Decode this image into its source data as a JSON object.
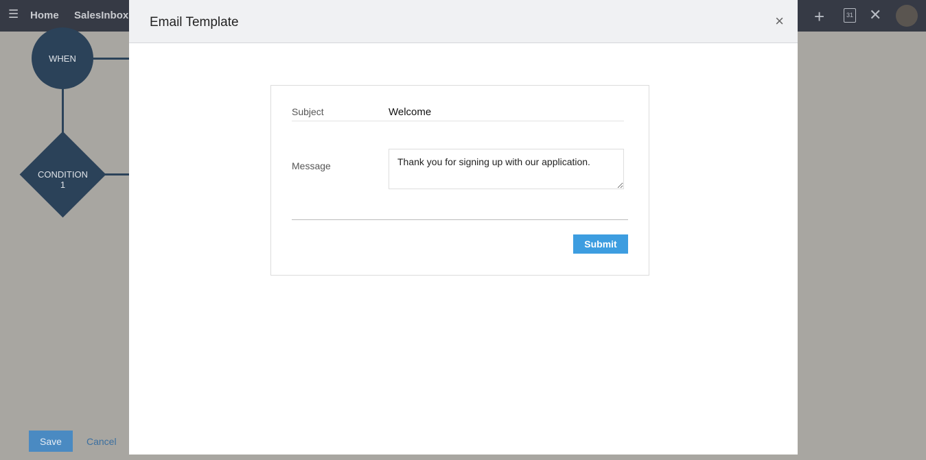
{
  "topbar": {
    "home": "Home",
    "salesinbox": "SalesInbox",
    "calendar_day": "31"
  },
  "flow": {
    "when": "WHEN",
    "condition": "CONDITION",
    "condition_num": "1"
  },
  "footer": {
    "save": "Save",
    "cancel": "Cancel"
  },
  "modal": {
    "title": "Email Template",
    "subject_label": "Subject",
    "subject_value": "Welcome",
    "message_label": "Message",
    "message_value": "Thank you for signing up with our application.",
    "submit": "Submit",
    "close": "×"
  }
}
